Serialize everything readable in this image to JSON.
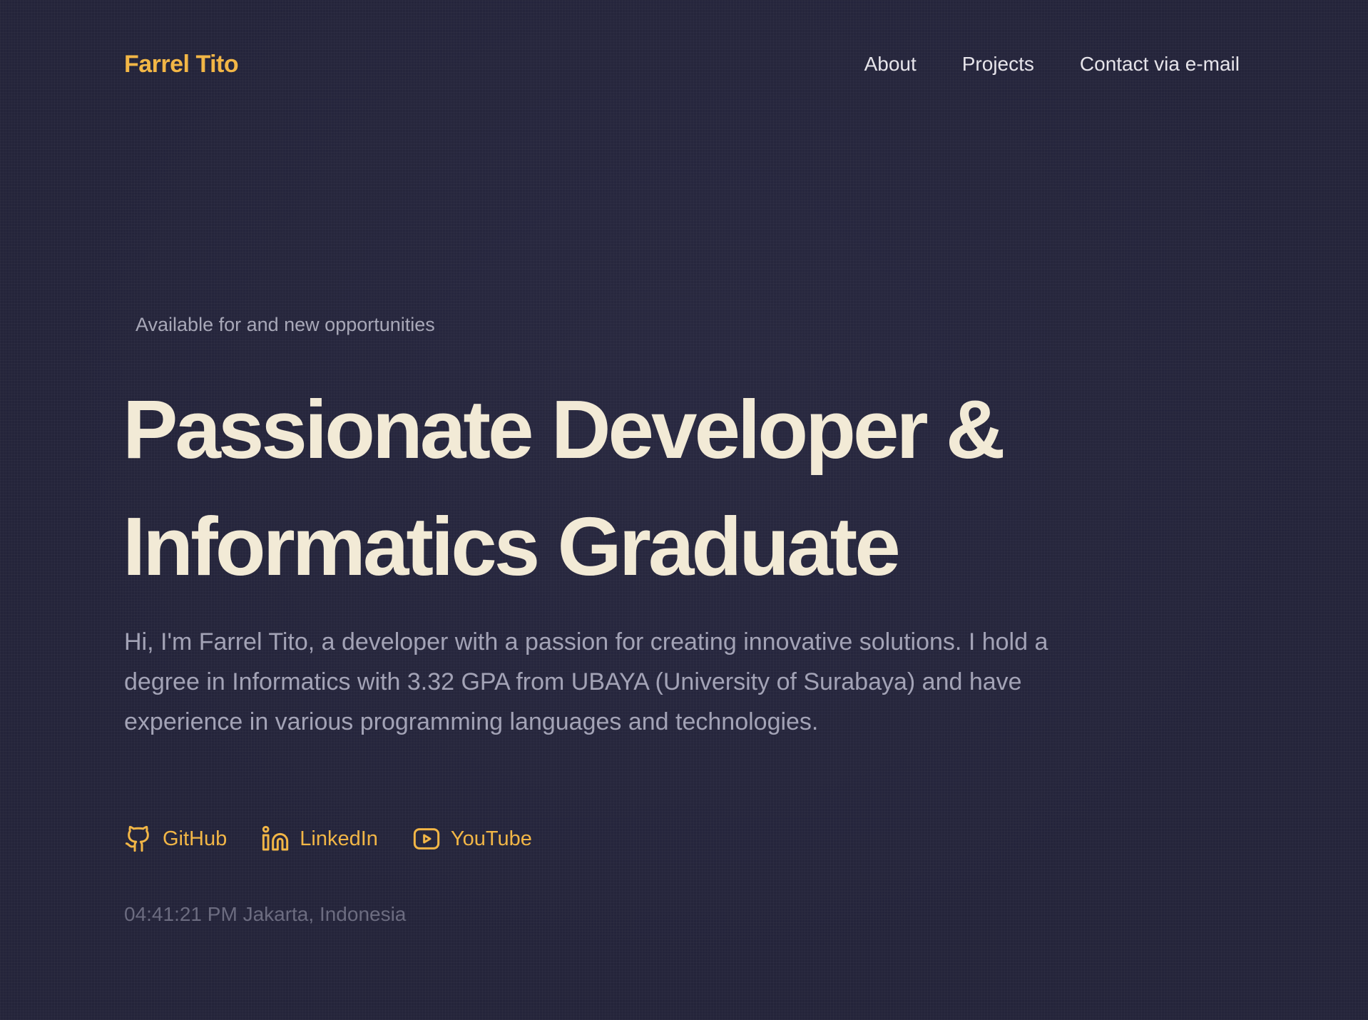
{
  "header": {
    "logo": "Farrel Tito",
    "nav": [
      {
        "label": "About"
      },
      {
        "label": "Projects"
      },
      {
        "label": "Contact via e-mail"
      }
    ]
  },
  "hero": {
    "availability": "Available for and new opportunities",
    "title_line1": "Passionate Developer &",
    "title_line2": "Informatics Graduate",
    "intro": "Hi, I'm Farrel Tito, a developer with a passion for creating innovative solutions. I hold a degree in Informatics with 3.32 GPA from UBAYA (University of Surabaya) and have experience in various programming languages and technologies."
  },
  "socials": [
    {
      "label": "GitHub",
      "icon": "github-icon"
    },
    {
      "label": "LinkedIn",
      "icon": "linkedin-icon"
    },
    {
      "label": "YouTube",
      "icon": "youtube-icon"
    }
  ],
  "clock": {
    "time": "04:41:21 PM",
    "location": "Jakarta, Indonesia"
  },
  "colors": {
    "background": "#24243a",
    "accent": "#f2b646",
    "heading": "#f2ead6",
    "body_text": "#a3a3b6",
    "muted": "#6c6c80"
  }
}
